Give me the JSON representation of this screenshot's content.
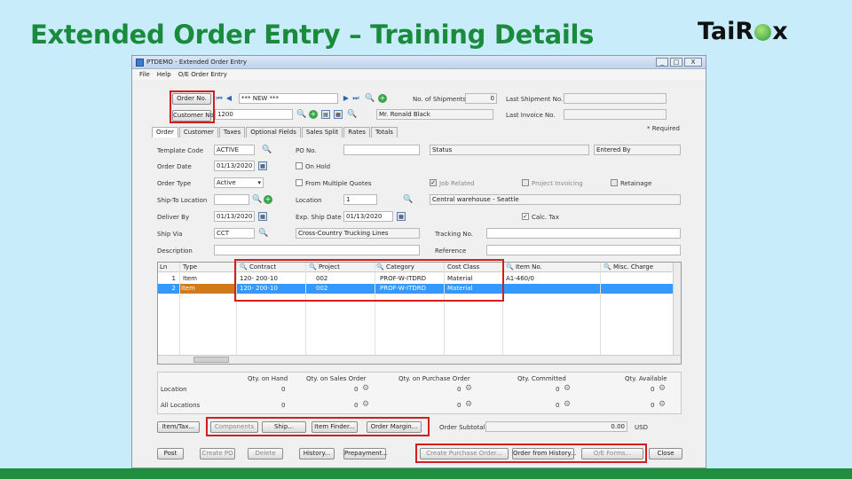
{
  "slide": {
    "title": "Extended Order Entry – Training Details",
    "logo_left": "Tai",
    "logo_r": "R",
    "logo_right": "x"
  },
  "window": {
    "title": "PTDEMO - Extended Order Entry",
    "min": "_",
    "max": "□",
    "close": "X"
  },
  "menu": [
    "File",
    "Help",
    "O/E Order Entry"
  ],
  "header": {
    "order_no_btn": "Order No.",
    "order_no": "*** NEW ***",
    "customer_no_btn": "Customer No.",
    "customer_no": "1200",
    "customer_name": "Mr. Ronald Black",
    "no_of_shipments_label": "No. of Shipments",
    "no_of_shipments": "0",
    "last_shipment_label": "Last Shipment No.",
    "last_invoice_label": "Last Invoice No.",
    "required": "Required"
  },
  "tabs": [
    "Order",
    "Customer",
    "Taxes",
    "Optional Fields",
    "Sales Split",
    "Rates",
    "Totals"
  ],
  "form": {
    "template_code_label": "Template Code",
    "template_code": "ACTIVE",
    "po_no_label": "PO No.",
    "status_label": "Status",
    "entered_by_label": "Entered By",
    "order_date_label": "Order Date",
    "order_date": "01/13/2020",
    "on_hold_label": "On Hold",
    "order_type_label": "Order Type",
    "order_type": "Active",
    "from_multiple_quotes_label": "From Multiple Quotes",
    "job_related_label": "Job Related",
    "project_invoicing_label": "Project Invoicing",
    "retainage_label": "Retainage",
    "ship_to_label": "Ship-To Location",
    "location_label": "Location",
    "location": "1",
    "location_name": "Central warehouse - Seattle",
    "deliver_by_label": "Deliver By",
    "deliver_by": "01/13/2020",
    "exp_ship_date_label": "Exp. Ship Date",
    "exp_ship_date": "01/13/2020",
    "calc_tax_label": "Calc. Tax",
    "ship_via_label": "Ship Via",
    "ship_via": "CCT",
    "ship_via_name": "Cross-Country Trucking Lines",
    "tracking_label": "Tracking No.",
    "description_label": "Description",
    "reference_label": "Reference"
  },
  "grid": {
    "columns": [
      "Ln",
      "Type",
      "Contract",
      "Project",
      "Category",
      "Cost Class",
      "Item No.",
      "Misc. Charge"
    ],
    "rows": [
      [
        "1",
        "Item",
        "120- 200-10",
        "002",
        "PROF-W-ITDRD",
        "Material",
        "A1-460/0",
        ""
      ],
      [
        "2",
        "Item",
        "120- 200-10",
        "002",
        "PROF-W-ITDRD",
        "Material",
        "",
        ""
      ]
    ]
  },
  "qty": {
    "headers": [
      "Qty. on Hand",
      "Qty. on Sales Order",
      "Qty. on Purchase Order",
      "Qty. Committed",
      "Qty. Available"
    ],
    "rows": [
      {
        "label": "Location",
        "values": [
          "0",
          "0",
          "0",
          "0",
          "0"
        ]
      },
      {
        "label": "All Locations",
        "values": [
          "0",
          "0",
          "0",
          "0",
          "0"
        ]
      }
    ]
  },
  "buttons_row1": {
    "item_tax": "Item/Tax...",
    "components": "Components",
    "ship": "Ship...",
    "item_finder": "Item Finder...",
    "order_margin": "Order Margin...",
    "order_subtotal_label": "Order Subtotal",
    "subtotal": "0.00",
    "currency": "USD"
  },
  "buttons_row2": {
    "post": "Post",
    "create_po": "Create PO",
    "delete": "Delete",
    "history": "History...",
    "prepayment": "Prepayment...",
    "create_purchase_order": "Create Purchase Order...",
    "order_from_history": "Order from History...",
    "oe_forms": "O/E Forms...",
    "close": "Close"
  }
}
